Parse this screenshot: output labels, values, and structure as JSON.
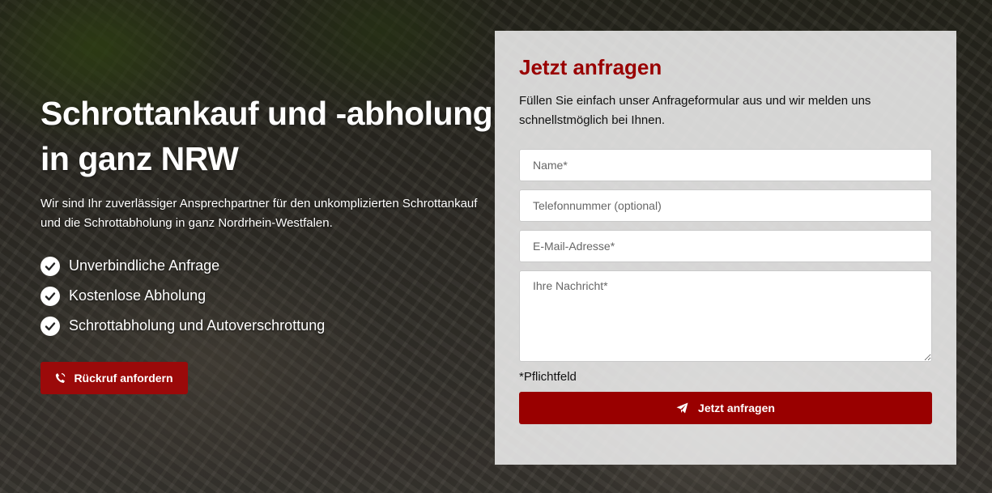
{
  "hero": {
    "title": "Schrottankauf und -abholung in ganz NRW",
    "intro": "Wir sind Ihr zuverlässiger Ansprechpartner für den unkomplizierten Schrottankauf und die Schrottabholung in ganz Nordrhein-Westfalen.",
    "features": [
      {
        "label": "Unverbindliche Anfrage",
        "icon": "check-circle-icon"
      },
      {
        "label": "Kostenlose Abholung",
        "icon": "check-circle-icon"
      },
      {
        "label": "Schrottabholung und Autoverschrottung",
        "icon": "check-circle-icon"
      }
    ],
    "callback_button": {
      "label": "Rückruf anfordern",
      "icon": "phone-icon"
    }
  },
  "form": {
    "title": "Jetzt anfragen",
    "intro": "Füllen Sie einfach unser Anfrageformular aus und wir melden uns schnellstmöglich bei Ihnen.",
    "fields": {
      "name_placeholder": "Name*",
      "phone_placeholder": "Telefonnummer (optional)",
      "email_placeholder": "E-Mail-Adresse*",
      "message_placeholder": "Ihre Nachricht*"
    },
    "required_note": "*Pflichtfeld",
    "submit": {
      "label": "Jetzt anfragen",
      "icon": "paper-plane-icon"
    }
  },
  "colors": {
    "accent": "#990000",
    "button_dark_red": "#9b0a0a",
    "card_bg": "#f2f2f2"
  }
}
